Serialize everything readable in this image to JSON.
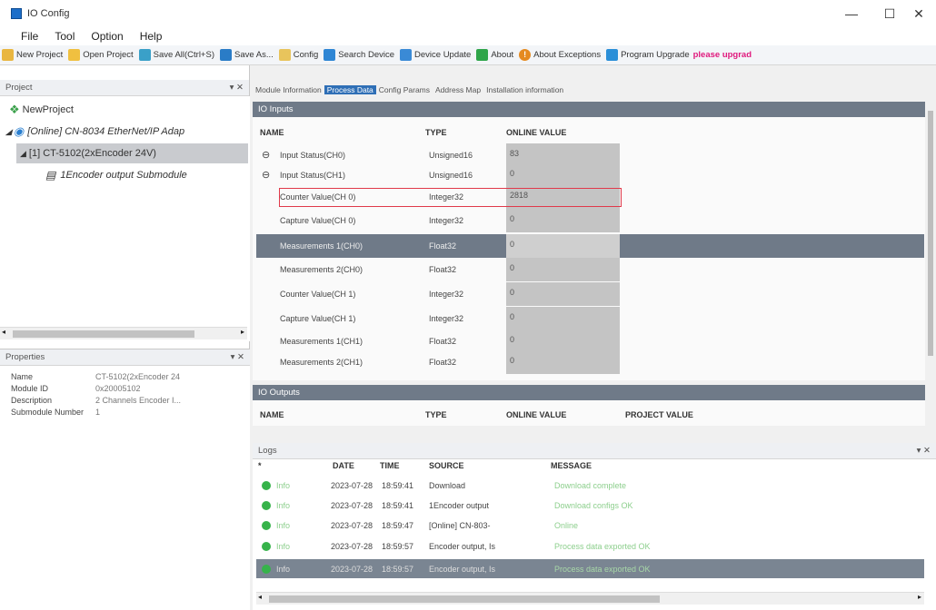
{
  "window": {
    "title": "IO Config",
    "minimize": "—",
    "maximize": "☐",
    "close": "✕"
  },
  "menu": [
    "File",
    "Tool",
    "Option",
    "Help"
  ],
  "toolbar": {
    "items": [
      "New Project",
      "Open Project",
      "Save All(Ctrl+S)",
      "Save As...",
      "Config",
      "Search Device",
      "Device Update",
      "About",
      "About Exceptions",
      "Program Upgrade"
    ],
    "warning": "please upgrad"
  },
  "project": {
    "header": "Project",
    "pin": "▾ ✕",
    "tree": [
      "NewProject",
      "[Online] CN-8034 EtherNet/IP Adap",
      "[1] CT-5102(2xEncoder 24V)",
      "1Encoder output Submodule"
    ]
  },
  "properties": {
    "header": "Properties",
    "rows": [
      {
        "k": "Name",
        "v": "CT-5102(2xEncoder 24"
      },
      {
        "k": "Module ID",
        "v": "0x20005102"
      },
      {
        "k": "Description",
        "v": "2 Channels Encoder I..."
      },
      {
        "k": "Submodule Number",
        "v": "1"
      }
    ]
  },
  "tabs": [
    "Module Information",
    "Process Data",
    "Config Params",
    "Address Map",
    "Installation information"
  ],
  "io_inputs": {
    "title": "IO Inputs",
    "col_name": "NAME",
    "col_type": "TYPE",
    "col_value": "ONLINE VALUE",
    "rows": [
      {
        "name": "Input Status(CH0)",
        "type": "Unsigned16",
        "value": "83"
      },
      {
        "name": "Input Status(CH1)",
        "type": "Unsigned16",
        "value": "0"
      },
      {
        "name": "Counter Value(CH 0)",
        "type": "Integer32",
        "value": "2818"
      },
      {
        "name": "Capture Value(CH 0)",
        "type": "Integer32",
        "value": "0"
      },
      {
        "name": "Measurements 1(CH0)",
        "type": "Float32",
        "value": "0"
      },
      {
        "name": "Measurements 2(CH0)",
        "type": "Float32",
        "value": "0"
      },
      {
        "name": "Counter Value(CH 1)",
        "type": "Integer32",
        "value": "0"
      },
      {
        "name": "Capture Value(CH 1)",
        "type": "Integer32",
        "value": "0"
      },
      {
        "name": "Measurements 1(CH1)",
        "type": "Float32",
        "value": "0"
      },
      {
        "name": "Measurements 2(CH1)",
        "type": "Float32",
        "value": "0"
      }
    ]
  },
  "io_outputs": {
    "title": "IO Outputs",
    "col_name": "NAME",
    "col_type": "TYPE",
    "col_value": "ONLINE VALUE",
    "col_project": "PROJECT VALUE"
  },
  "logs": {
    "header": "Logs",
    "col_date": "DATE",
    "col_time": "TIME",
    "col_source": "SOURCE",
    "col_message": "MESSAGE",
    "rows": [
      {
        "level": "Info",
        "date": "2023-07-28",
        "time": "18:59:41",
        "source": "Download",
        "message": "Download complete"
      },
      {
        "level": "Info",
        "date": "2023-07-28",
        "time": "18:59:41",
        "source": "1Encoder output",
        "message": "Download configs OK"
      },
      {
        "level": "Info",
        "date": "2023-07-28",
        "time": "18:59:47",
        "source": "[Online] CN-803-",
        "message": "Online"
      },
      {
        "level": "Info",
        "date": "2023-07-28",
        "time": "18:59:57",
        "source": "Encoder output, Is",
        "message": "Process data exported OK"
      },
      {
        "level": "Info",
        "date": "2023-07-28",
        "time": "18:59:57",
        "source": "Encoder output, Is",
        "message": "Process data exported OK"
      }
    ]
  }
}
